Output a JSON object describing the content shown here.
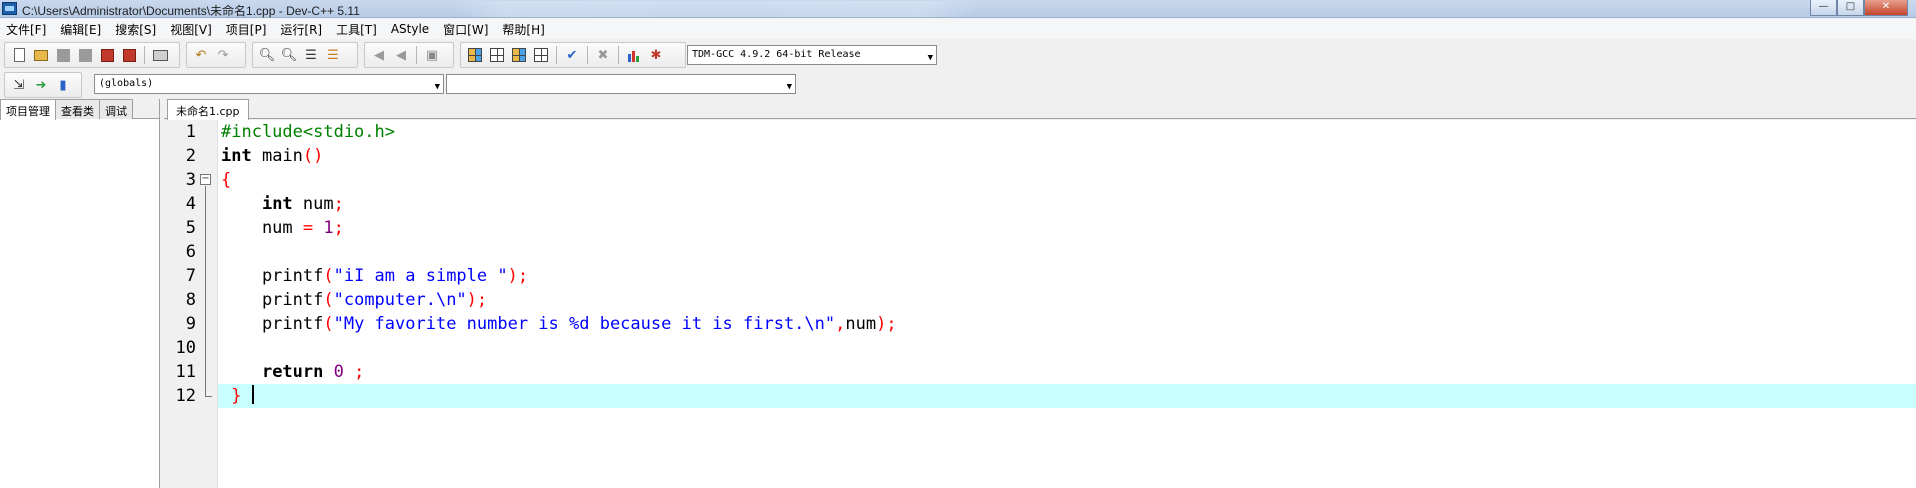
{
  "window": {
    "title": "C:\\Users\\Administrator\\Documents\\未命名1.cpp - Dev-C++ 5.11",
    "controls": {
      "minimize": "—",
      "maximize": "□",
      "close": "✕"
    }
  },
  "menu": [
    "文件[F]",
    "编辑[E]",
    "搜索[S]",
    "视图[V]",
    "项目[P]",
    "运行[R]",
    "工具[T]",
    "AStyle",
    "窗口[W]",
    "帮助[H]"
  ],
  "toolbar": {
    "compiler": "TDM-GCC 4.9.2 64-bit Release",
    "scope_combo": "(globals)",
    "member_combo": ""
  },
  "left_panel": {
    "tabs": [
      "项目管理",
      "查看类",
      "调试"
    ],
    "active_tab": "项目管理"
  },
  "editor": {
    "tab": "未命名1.cpp",
    "line_numbers": [
      "1",
      "2",
      "3",
      "4",
      "5",
      "6",
      "7",
      "8",
      "9",
      "10",
      "11",
      "12"
    ],
    "current_line": 12,
    "colors": {
      "current_line_bg": "#c8ffff",
      "preprocessor": "#008000",
      "string": "#0000ff",
      "symbol": "#ff0000",
      "number": "#800080"
    },
    "code": {
      "l1": "#include<stdio.h>",
      "l2_kw": "int",
      "l2_rest": " main",
      "l2_sym": "()",
      "l3": "{",
      "l4_indent": "    ",
      "l4_kw": "int",
      "l4_rest": " num",
      "l4_sym": ";",
      "l5_rest": "    num ",
      "l5_eq": "=",
      "l5_num": " 1",
      "l5_sym": ";",
      "l7_fn": "    printf",
      "l7_open": "(",
      "l7_str": "\"iI am a simple \"",
      "l7_close": ");",
      "l8_fn": "    printf",
      "l8_open": "(",
      "l8_str": "\"computer.\\n\"",
      "l8_close": ");",
      "l9_fn": "    printf",
      "l9_open": "(",
      "l9_str": "\"My favorite number is %d because it is first.\\n\"",
      "l9_comma": ",",
      "l9_rest": "num",
      "l9_close": ");",
      "l11_indent": "    ",
      "l11_kw": "return",
      "l11_num": " 0",
      "l11_sym": " ;",
      "l12_lead": " ",
      "l12_sym": "}"
    }
  }
}
